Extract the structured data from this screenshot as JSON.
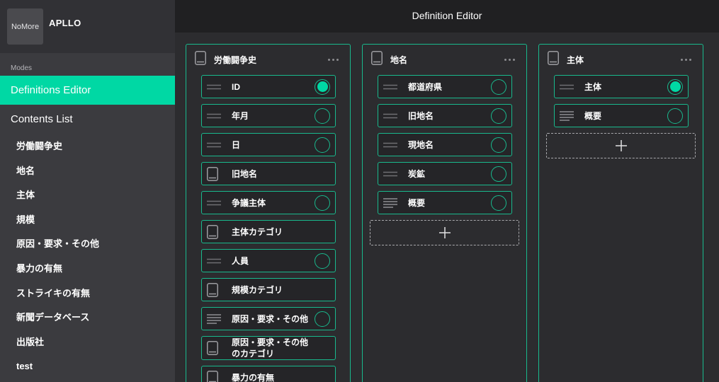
{
  "theme": {
    "accent": "#00d8a4",
    "border": "#19b98d",
    "sidebar_bg": "#3b3b3f",
    "main_bg": "#2c2c2f",
    "header_bg": "#202022"
  },
  "sidebar": {
    "logo_text": "NoMore",
    "app_name": "APLLO",
    "modes_label": "Modes",
    "modes": [
      {
        "label": "Definitions Editor",
        "active": true
      },
      {
        "label": "Contents List",
        "active": false
      }
    ],
    "contents": [
      "労働闘争史",
      "地名",
      "主体",
      "規模",
      "原因・要求・その他",
      "暴力の有無",
      "ストライキの有無",
      "新聞データベース",
      "出版社",
      "test"
    ]
  },
  "header": {
    "title": "Definition Editor"
  },
  "columns": [
    {
      "title": "労働闘争史",
      "icon": "book-icon",
      "menu_icon": "more-horizontal-icon",
      "fields": [
        {
          "label": "ID",
          "icon": "short-text-icon",
          "radio_selected": true
        },
        {
          "label": "年月",
          "icon": "short-text-icon",
          "radio_selected": false
        },
        {
          "label": "日",
          "icon": "short-text-icon",
          "radio_selected": false
        },
        {
          "label": "旧地名",
          "icon": "book-icon"
        },
        {
          "label": "争議主体",
          "icon": "short-text-icon",
          "radio_selected": false
        },
        {
          "label": "主体カテゴリ",
          "icon": "book-icon"
        },
        {
          "label": "人員",
          "icon": "short-text-icon",
          "radio_selected": false
        },
        {
          "label": "規模カテゴリ",
          "icon": "book-icon"
        },
        {
          "label": "原因・要求・その他",
          "icon": "long-text-icon",
          "radio_selected": false
        },
        {
          "label": "原因・要求・その他のカテゴリ",
          "icon": "book-icon"
        },
        {
          "label": "暴力の有無",
          "icon": "book-icon"
        }
      ]
    },
    {
      "title": "地名",
      "icon": "book-icon",
      "menu_icon": "more-horizontal-icon",
      "fields": [
        {
          "label": "都道府県",
          "icon": "short-text-icon",
          "radio_selected": false
        },
        {
          "label": "旧地名",
          "icon": "short-text-icon",
          "radio_selected": false
        },
        {
          "label": "現地名",
          "icon": "short-text-icon",
          "radio_selected": false
        },
        {
          "label": "炭鉱",
          "icon": "short-text-icon",
          "radio_selected": false
        },
        {
          "label": "概要",
          "icon": "long-text-icon",
          "radio_selected": false
        }
      ],
      "add_icon": "plus-icon"
    },
    {
      "title": "主体",
      "icon": "book-icon",
      "menu_icon": "more-horizontal-icon",
      "fields": [
        {
          "label": "主体",
          "icon": "short-text-icon",
          "radio_selected": true
        },
        {
          "label": "概要",
          "icon": "long-text-icon",
          "radio_selected": false
        }
      ],
      "add_icon": "plus-icon"
    }
  ]
}
